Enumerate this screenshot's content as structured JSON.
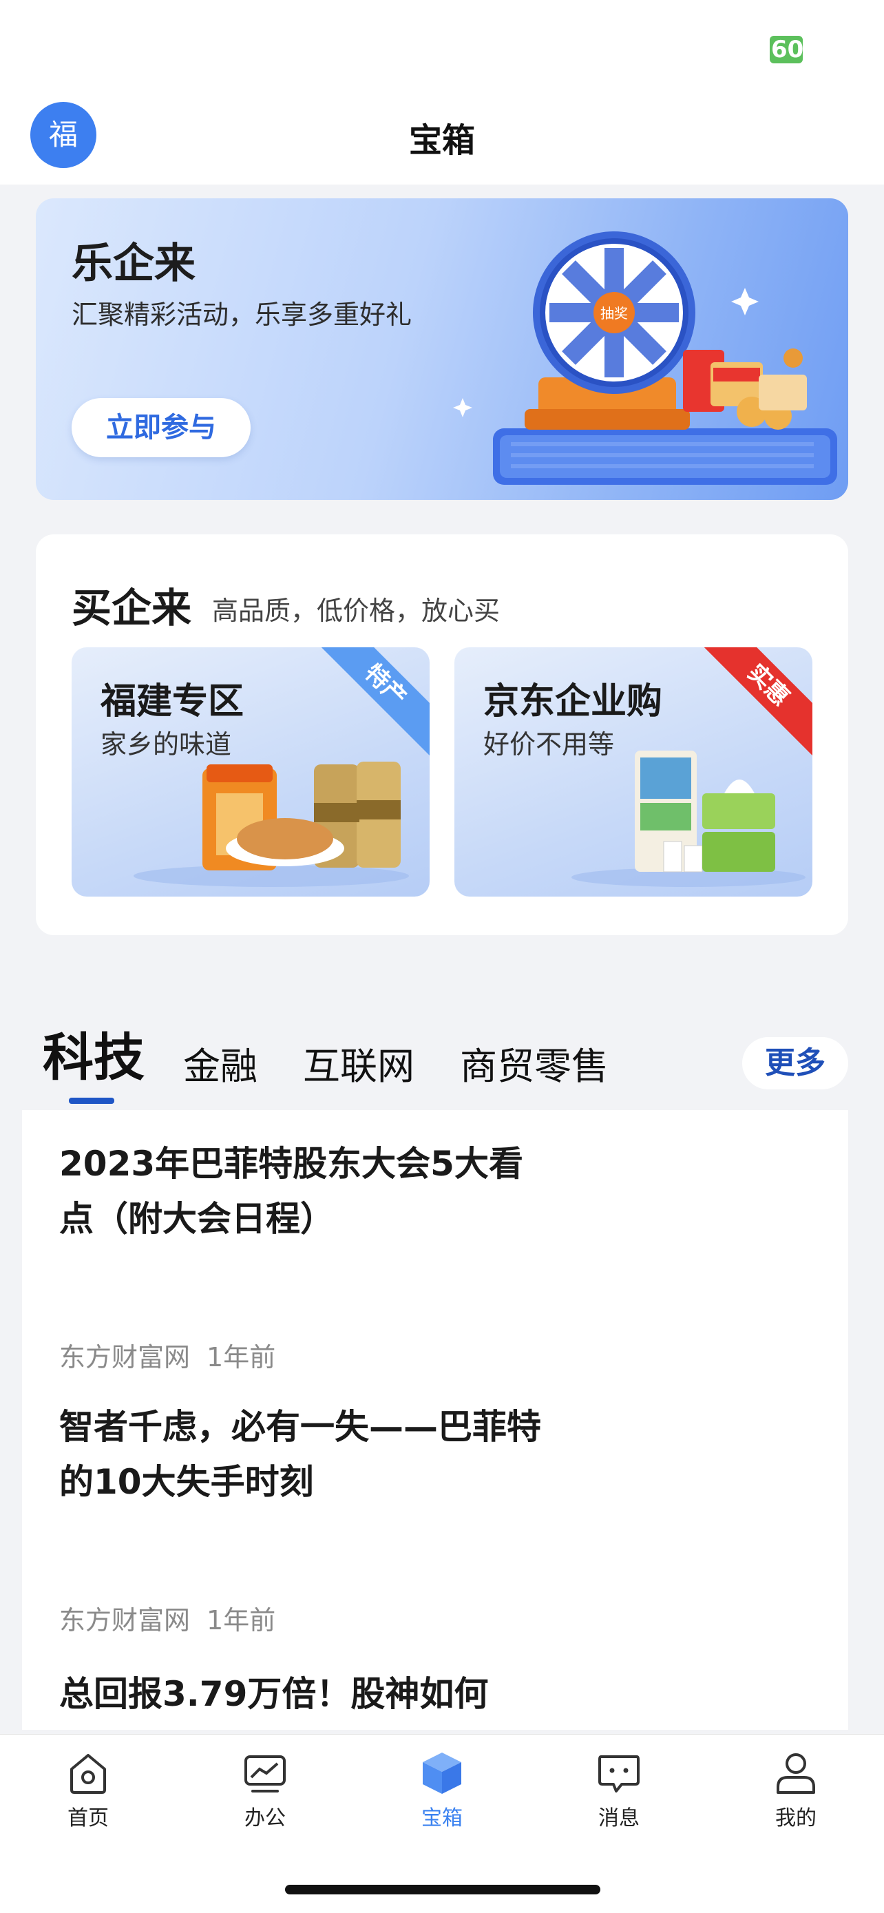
{
  "status_bar": {
    "battery": "60"
  },
  "header": {
    "avatar_char": "福",
    "title": "宝箱"
  },
  "banner": {
    "title": "乐企来",
    "subtitle": "汇聚精彩活动，乐享多重好礼",
    "cta": "立即参与",
    "wheel_center": "抽奖",
    "illustration": "prize-wheel-illustration"
  },
  "shop": {
    "title": "买企来",
    "subtitle": "高品质，低价格，放心买",
    "tiles": [
      {
        "title": "福建专区",
        "subtitle": "家乡的味道",
        "tag": "特产",
        "tag_color": "#5b9cf2"
      },
      {
        "title": "京东企业购",
        "subtitle": "好价不用等",
        "tag": "实惠",
        "tag_color": "#e5322d"
      }
    ]
  },
  "news_tabs": {
    "items": [
      "科技",
      "金融",
      "互联网",
      "商贸零售"
    ],
    "active": "科技",
    "more": "更多"
  },
  "news": [
    {
      "title": "2023年巴菲特股东大会5大看点（附大会日程）",
      "source": "东方财富网",
      "time": "1年前"
    },
    {
      "title": "智者千虑，必有一失——巴菲特的10大失手时刻",
      "source": "东方财富网",
      "time": "1年前"
    },
    {
      "title": "总回报3.79万倍！股神如何",
      "source": "",
      "time": ""
    }
  ],
  "bottom_nav": [
    {
      "label": "首页",
      "icon": "home-icon"
    },
    {
      "label": "办公",
      "icon": "office-chart-icon"
    },
    {
      "label": "宝箱",
      "icon": "treasure-box-icon",
      "active": true
    },
    {
      "label": "消息",
      "icon": "message-icon"
    },
    {
      "label": "我的",
      "icon": "profile-icon"
    }
  ],
  "colors": {
    "accent": "#3b82f0",
    "tab_underline": "#1f56c6",
    "avatar": "#3d7ff0"
  }
}
